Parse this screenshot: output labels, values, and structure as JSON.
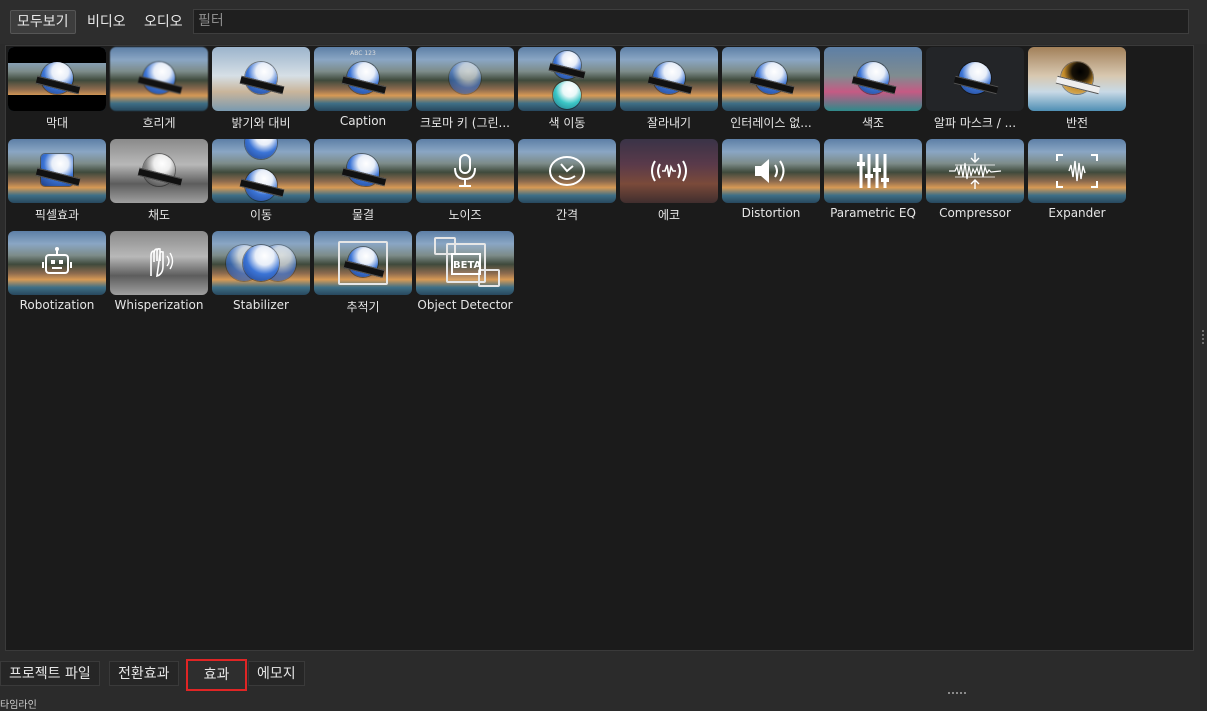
{
  "toolbar": {
    "filters": [
      "모두보기",
      "비디오",
      "오디오"
    ],
    "search_placeholder": "필터"
  },
  "effects": [
    {
      "label": "막대",
      "icon": "bars-logo"
    },
    {
      "label": "흐리게",
      "icon": "blur-logo"
    },
    {
      "label": "밝기와 대비",
      "icon": "brightness-logo"
    },
    {
      "label": "Caption",
      "icon": "caption-logo",
      "thumb_text": "ABC 123"
    },
    {
      "label": "크로마 키 (그린...",
      "icon": "chroma-key-logo"
    },
    {
      "label": "색 이동",
      "icon": "color-shift-logo"
    },
    {
      "label": "잘라내기",
      "icon": "crop-logo"
    },
    {
      "label": "인터레이스 없...",
      "icon": "deinterlace-logo"
    },
    {
      "label": "색조",
      "icon": "hue-logo"
    },
    {
      "label": "알파 마스크 / ...",
      "icon": "alpha-mask-logo"
    },
    {
      "label": "반전",
      "icon": "negate-logo"
    },
    {
      "label": "픽셀효과",
      "icon": "pixelate-logo"
    },
    {
      "label": "채도",
      "icon": "saturation-logo"
    },
    {
      "label": "이동",
      "icon": "shift-logo"
    },
    {
      "label": "물결",
      "icon": "wave-logo"
    },
    {
      "label": "노이즈",
      "icon": "microphone-icon"
    },
    {
      "label": "간격",
      "icon": "delay-icon"
    },
    {
      "label": "에코",
      "icon": "echo-icon"
    },
    {
      "label": "Distortion",
      "icon": "speaker-icon"
    },
    {
      "label": "Parametric EQ",
      "icon": "eq-sliders-icon"
    },
    {
      "label": "Compressor",
      "icon": "compressor-icon"
    },
    {
      "label": "Expander",
      "icon": "expander-icon"
    },
    {
      "label": "Robotization",
      "icon": "robot-icon"
    },
    {
      "label": "Whisperization",
      "icon": "whisper-icon"
    },
    {
      "label": "Stabilizer",
      "icon": "stabilizer-logo"
    },
    {
      "label": "추적기",
      "icon": "tracker-icon"
    },
    {
      "label": "Object Detector",
      "icon": "object-detector-icon",
      "thumb_text": "BETA"
    }
  ],
  "bottom_tabs": [
    "프로젝트 파일",
    "전환효과",
    "효과",
    "에모지"
  ],
  "cutoff_text": "타임라인"
}
